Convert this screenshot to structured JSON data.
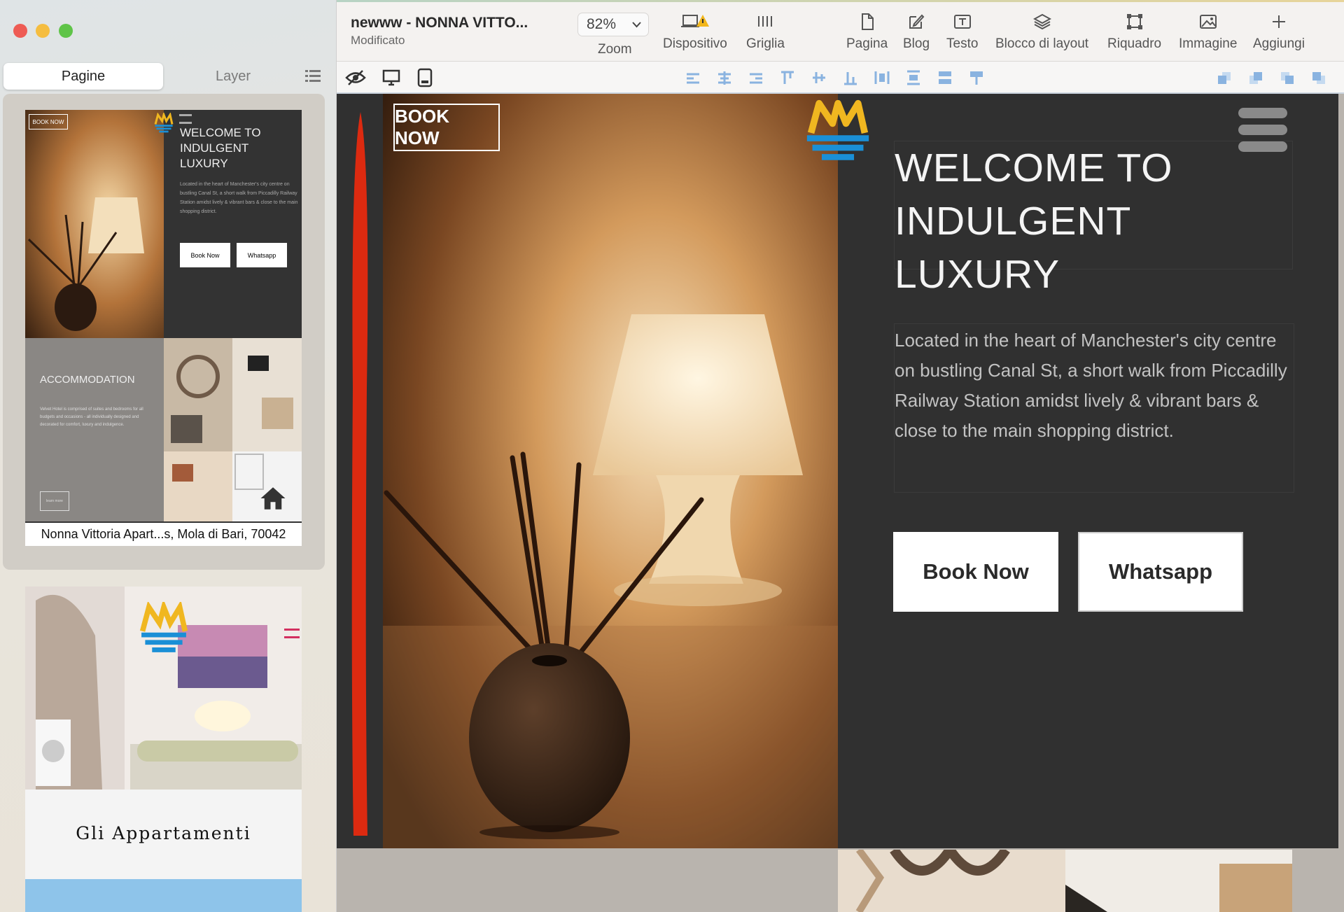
{
  "window": {
    "title": "newww - NONNA VITTO...",
    "status": "Modificato"
  },
  "sidebar": {
    "tabs": [
      {
        "label": "Pagine"
      },
      {
        "label": "Layer"
      }
    ],
    "pages": [
      {
        "caption": "Nonna Vittoria Apart...s, Mola di Bari, 70042",
        "book_now": "BOOK NOW",
        "welcome": "WELCOME TO INDULGENT LUXURY",
        "text": "Located in the heart of Manchester's city centre on bustling Canal St, a short walk from Piccadilly Railway Station amidst lively & vibrant bars & close to the main shopping district.",
        "btn1": "Book Now",
        "btn2": "Whatsapp",
        "accommodation": "ACCOMMODATION",
        "acc_text": "Velvet Hotel is comprised of suites and bedrooms for all budgets and occasions - all individually designed and decorated for comfort, luxury and indulgence.",
        "learn_more": "learn more"
      },
      {
        "title": "Gli Appartamenti"
      }
    ]
  },
  "toolbar": {
    "zoom": "82%",
    "items": [
      {
        "label": "Zoom"
      },
      {
        "label": "Dispositivo"
      },
      {
        "label": "Griglia"
      },
      {
        "label": "Pagina"
      },
      {
        "label": "Blog"
      },
      {
        "label": "Testo"
      },
      {
        "label": "Blocco di layout"
      },
      {
        "label": "Riquadro"
      },
      {
        "label": "Immagine"
      },
      {
        "label": "Aggiungi"
      }
    ]
  },
  "canvas": {
    "book_now": "BOOK NOW",
    "heading_line1": "WELCOME TO",
    "heading_line2": "INDULGENT LUXURY",
    "body": "Located in the heart of Manchester's city centre on bustling Canal St, a short walk from Piccadilly Railway Station amidst lively & vibrant bars & close to the main shopping district.",
    "btn_book": "Book Now",
    "btn_whatsapp": "Whatsapp"
  },
  "colors": {
    "accent_red": "#dc2a10",
    "dark_bg": "#303030",
    "logo_yellow": "#f0b720",
    "logo_blue": "#1a8fd6"
  },
  "icons": [
    "eye-slash-icon",
    "desktop-icon",
    "mobile-icon",
    "list-icon",
    "home-icon",
    "hamburger-menu-icon"
  ]
}
